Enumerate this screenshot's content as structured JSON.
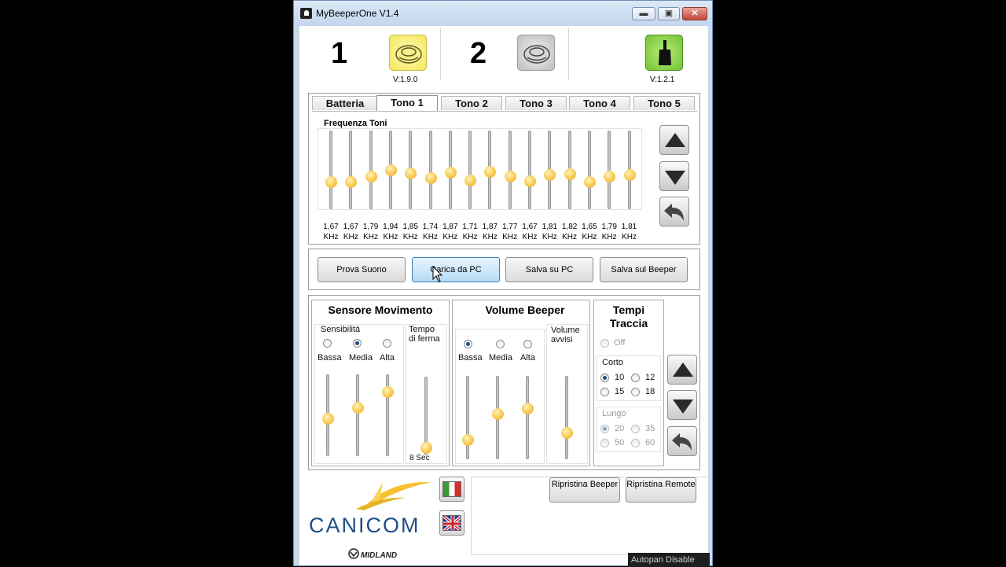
{
  "window": {
    "title": "MyBeeperOne V1.4",
    "min_glyph": "▬",
    "max_glyph": "▣",
    "close_glyph": "✕"
  },
  "header": {
    "device1": {
      "number": "1",
      "version": "V:1.9.0"
    },
    "device2": {
      "number": "2"
    },
    "remote": {
      "version": "V:1.2.1"
    }
  },
  "tabs": [
    "Batteria",
    "Tono 1",
    "Tono 2",
    "Tono 3",
    "Tono 4",
    "Tono 5"
  ],
  "active_tab": "Tono 1",
  "tone_panel": {
    "label": "Frequenza Toni",
    "unit": "KHz",
    "frequencies": [
      "1,67",
      "1,67",
      "1,79",
      "1,94",
      "1,85",
      "1,74",
      "1,87",
      "1,71",
      "1,87",
      "1,77",
      "1,67",
      "1,81",
      "1,82",
      "1,65",
      "1,79",
      "1,81"
    ],
    "slider_levels": [
      0.33,
      0.33,
      0.41,
      0.5,
      0.45,
      0.38,
      0.46,
      0.35,
      0.47,
      0.4,
      0.34,
      0.43,
      0.44,
      0.33,
      0.41,
      0.43
    ]
  },
  "actions": {
    "prova": "Prova Suono",
    "carica": "Carica da PC",
    "salva_pc": "Salva su PC",
    "salva_beeper": "Salva sul Beeper"
  },
  "sensore": {
    "title": "Sensore Movimento",
    "sensibilita_label": "Sensibilità",
    "options": [
      "Bassa",
      "Media",
      "Alta"
    ],
    "selected": "Media",
    "levels": [
      0.45,
      0.6,
      0.82
    ],
    "tempo_label": "Tempo di ferma",
    "tempo_value": "8 Sec",
    "tempo_level": 0.05
  },
  "volume": {
    "title": "Volume Beeper",
    "options": [
      "Bassa",
      "Media",
      "Alta"
    ],
    "selected": "Bassa",
    "levels": [
      0.2,
      0.55,
      0.62
    ],
    "avvisi_label": "Volume avvisi",
    "avvisi_level": 0.3
  },
  "tempi": {
    "title": "Tempi Traccia",
    "off": "Off",
    "corto_label": "Corto",
    "corto_options": [
      "10",
      "12",
      "15",
      "18"
    ],
    "corto_selected": "10",
    "lungo_label": "Lungo",
    "lungo_options": [
      "20",
      "35",
      "50",
      "60"
    ],
    "lungo_selected": "20"
  },
  "footer": {
    "brand": "CANICOM",
    "sub_brand": "MIDLAND",
    "reset_beeper": "Ripristina Beeper",
    "reset_remote": "Ripristina Remote",
    "status": "Autopan Disable"
  }
}
